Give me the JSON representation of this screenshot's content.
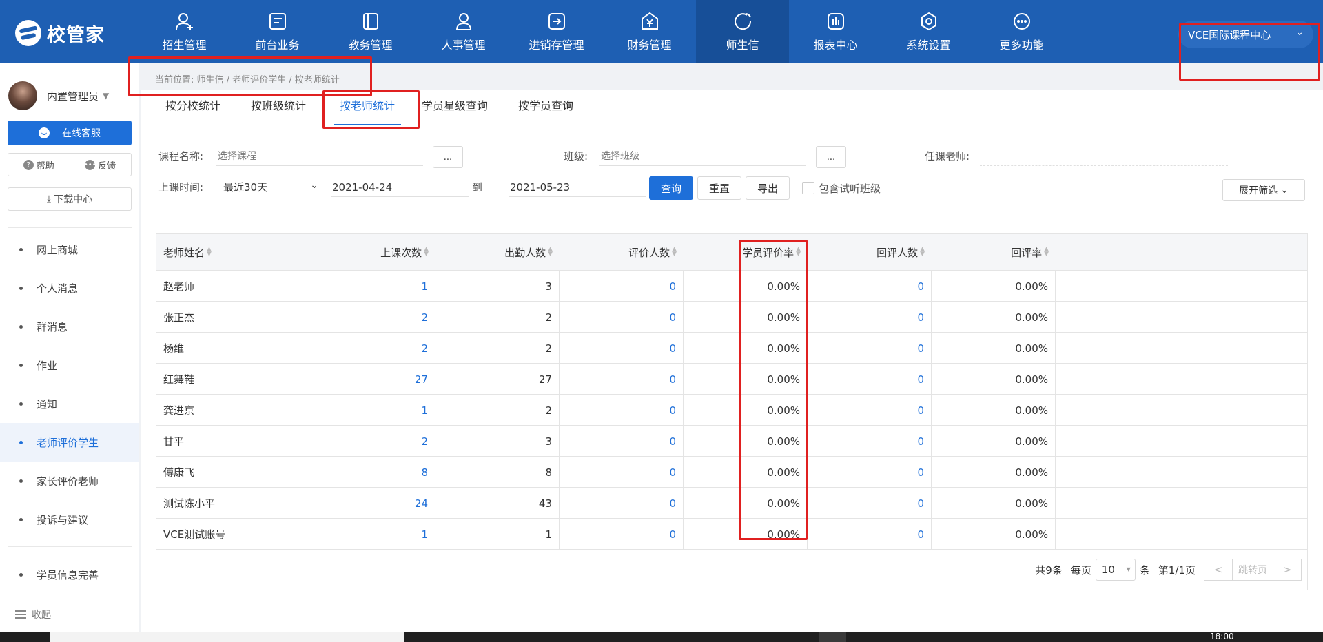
{
  "app": {
    "logo_text": "校管家",
    "nav": [
      {
        "label": "招生管理",
        "icon": "user-add-icon"
      },
      {
        "label": "前台业务",
        "icon": "monitor-icon"
      },
      {
        "label": "教务管理",
        "icon": "book-icon"
      },
      {
        "label": "人事管理",
        "icon": "person-icon"
      },
      {
        "label": "进销存管理",
        "icon": "exchange-icon"
      },
      {
        "label": "财务管理",
        "icon": "yen-icon"
      },
      {
        "label": "师生信",
        "icon": "chat-icon",
        "active": true
      },
      {
        "label": "报表中心",
        "icon": "chart-icon"
      },
      {
        "label": "系统设置",
        "icon": "gear-icon"
      },
      {
        "label": "更多功能",
        "icon": "more-icon"
      }
    ],
    "campus": "VCE国际课程中心"
  },
  "sidebar": {
    "user_name": "内置管理员",
    "service_label": "在线客服",
    "help_label": "帮助",
    "feedback_label": "反馈",
    "download_label": "下载中心",
    "items": [
      {
        "label": "网上商城"
      },
      {
        "label": "个人消息"
      },
      {
        "label": "群消息"
      },
      {
        "label": "作业"
      },
      {
        "label": "通知"
      },
      {
        "label": "老师评价学生",
        "active": true
      },
      {
        "label": "家长评价老师"
      },
      {
        "label": "投诉与建议"
      },
      {
        "label": "学员信息完善"
      }
    ],
    "collapse_label": "收起"
  },
  "breadcrumb": "当前位置:  师生信 / 老师评价学生 / 按老师统计",
  "tabs": [
    "按分校统计",
    "按班级统计",
    "按老师统计",
    "学员星级查询",
    "按学员查询"
  ],
  "filters": {
    "course_label": "课程名称:",
    "course_placeholder": "选择课程",
    "class_label": "班级:",
    "class_placeholder": "选择班级",
    "teacher_label": "任课老师:",
    "time_label": "上课时间:",
    "time_range": "最近30天",
    "date_from": "2021-04-24",
    "to_label": "到",
    "date_to": "2021-05-23",
    "query_btn": "查询",
    "reset_btn": "重置",
    "export_btn": "导出",
    "trial_label": "包含试听班级",
    "expand_btn": "展开筛选",
    "dots": "..."
  },
  "table": {
    "columns": [
      "老师姓名",
      "上课次数",
      "出勤人数",
      "评价人数",
      "学员评价率",
      "回评人数",
      "回评率"
    ],
    "rows": [
      [
        "赵老师",
        "1",
        "3",
        "0",
        "0.00%",
        "0",
        "0.00%"
      ],
      [
        "张正杰",
        "2",
        "2",
        "0",
        "0.00%",
        "0",
        "0.00%"
      ],
      [
        "杨维",
        "2",
        "2",
        "0",
        "0.00%",
        "0",
        "0.00%"
      ],
      [
        "红舞鞋",
        "27",
        "27",
        "0",
        "0.00%",
        "0",
        "0.00%"
      ],
      [
        "龚进京",
        "1",
        "2",
        "0",
        "0.00%",
        "0",
        "0.00%"
      ],
      [
        "甘平",
        "2",
        "3",
        "0",
        "0.00%",
        "0",
        "0.00%"
      ],
      [
        "傅康飞",
        "8",
        "8",
        "0",
        "0.00%",
        "0",
        "0.00%"
      ],
      [
        "测试陈小平",
        "24",
        "43",
        "0",
        "0.00%",
        "0",
        "0.00%"
      ],
      [
        "VCE测试账号",
        "1",
        "1",
        "0",
        "0.00%",
        "0",
        "0.00%"
      ]
    ]
  },
  "pagination": {
    "total": "共9条",
    "per_page_label": "每页",
    "per_page": "10",
    "unit": "条",
    "page_info": "第1/1页",
    "jump_label": "跳转页"
  },
  "taskbar": {
    "clock": "18:00"
  },
  "colors": {
    "primary": "#1e6fd9",
    "topbar": "#1e5fb3",
    "annotation": "#e02020"
  }
}
